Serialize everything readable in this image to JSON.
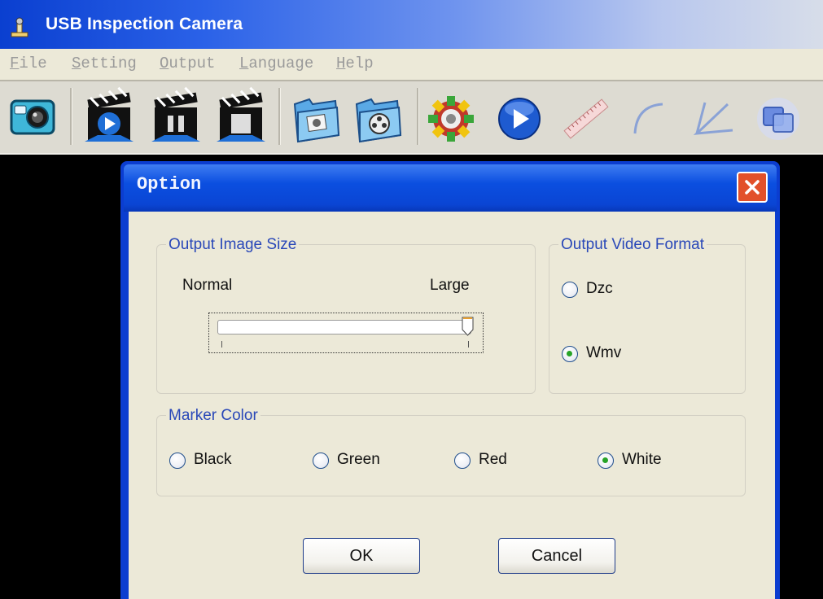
{
  "app": {
    "title": "USB Inspection Camera"
  },
  "menu": {
    "items": [
      "File",
      "Setting",
      "Output",
      "Language",
      "Help"
    ]
  },
  "toolbar": {
    "icons": [
      "camera-icon",
      "video-record-icon",
      "video-pause-icon",
      "video-stop-icon",
      "photo-folder-icon",
      "video-folder-icon",
      "settings-gear-icon",
      "play-icon",
      "ruler-icon",
      "arc-icon",
      "angle-icon",
      "overlay-icon"
    ]
  },
  "dialog": {
    "title": "Option",
    "output_image_size": {
      "legend": "Output Image Size",
      "min_label": "Normal",
      "max_label": "Large",
      "value_fraction": 1.0
    },
    "output_video_format": {
      "legend": "Output Video Format",
      "options": [
        "Dzc",
        "Wmv"
      ],
      "selected": "Wmv"
    },
    "marker_color": {
      "legend": "Marker Color",
      "options": [
        "Black",
        "Green",
        "Red",
        "White"
      ],
      "selected": "White"
    },
    "ok_label": "OK",
    "cancel_label": "Cancel"
  },
  "colors": {
    "title_bar": "#0a3fd0",
    "dialog_frame": "#0b3dd0",
    "dialog_body": "#ece9d8",
    "legend_text": "#2a48b8",
    "close_button": "#e2502a",
    "radio_checked": "#27a327"
  }
}
